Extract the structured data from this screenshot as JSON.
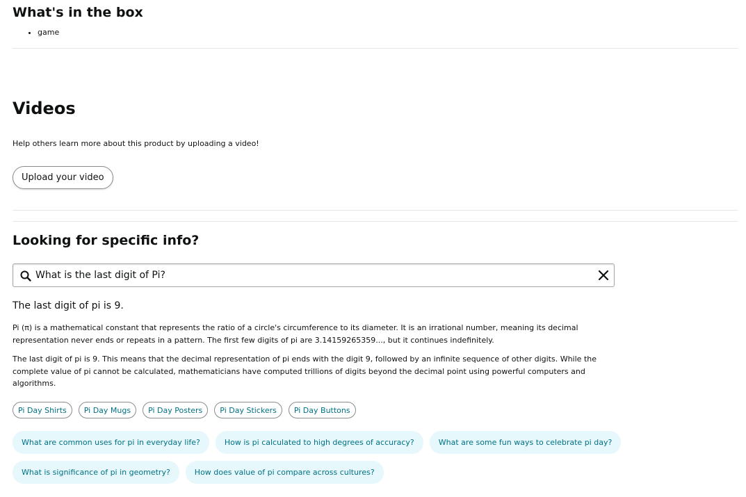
{
  "box": {
    "title": "What's in the box",
    "items": [
      "game"
    ]
  },
  "videos": {
    "title": "Videos",
    "help_text": "Help others learn more about this product by uploading a video!",
    "upload_label": "Upload your video"
  },
  "info": {
    "title": "Looking for specific info?",
    "search_value": "What is the last digit of Pi?",
    "answer_headline": "The last digit of pi is 9.",
    "paragraphs": [
      "Pi (π) is a mathematical constant that represents the ratio of a circle's circumference to its diameter. It is an irrational number, meaning its decimal representation never ends or repeats in a pattern. The first few digits of pi are 3.14159265359..., but it continues indefinitely.",
      "The last digit of pi is 9. This means that the decimal representation of pi ends with the digit 9, followed by an infinite sequence of other digits. While the complete value of pi cannot be calculated, mathematicians have computed trillions of digits beyond the decimal point using powerful computers and algorithms."
    ],
    "chips": [
      "Pi Day Shirts",
      "Pi Day Mugs",
      "Pi Day Posters",
      "Pi Day Stickers",
      "Pi Day Buttons"
    ],
    "suggestions": [
      "What are common uses for pi in everyday life?",
      "How is pi calculated to high degrees of accuracy?",
      "What are some fun ways to celebrate pi day?",
      "What is significance of pi in geometry?",
      "How does value of pi compare across cultures?"
    ]
  },
  "icons": {
    "search": "search-icon",
    "clear": "close-icon"
  },
  "colors": {
    "link_teal": "#007185",
    "suggestion_bg": "#e6f8fb",
    "divider": "#e3e6e6"
  }
}
